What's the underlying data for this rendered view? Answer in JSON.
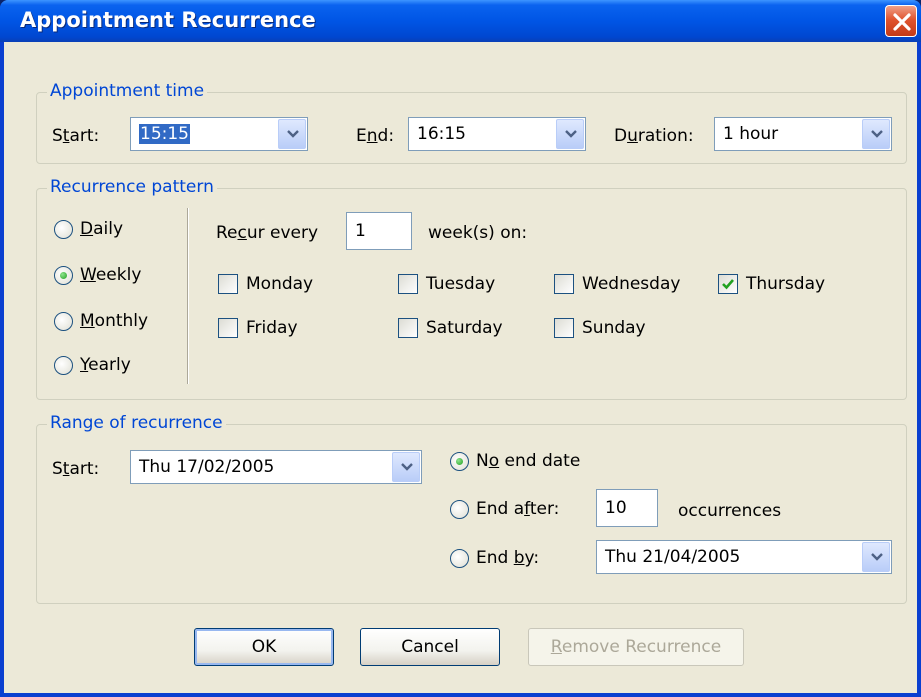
{
  "window": {
    "title": "Appointment Recurrence",
    "close_icon": "close-icon"
  },
  "appointment_time": {
    "legend": "Appointment time",
    "start_label": "Start:",
    "start_value": "15:15",
    "end_label": "End:",
    "end_value": "16:15",
    "duration_label": "Duration:",
    "duration_value": "1 hour"
  },
  "recurrence_pattern": {
    "legend": "Recurrence pattern",
    "options": [
      {
        "label": "Daily",
        "selected": false
      },
      {
        "label": "Weekly",
        "selected": true
      },
      {
        "label": "Monthly",
        "selected": false
      },
      {
        "label": "Yearly",
        "selected": false
      }
    ],
    "recur_every_label": "Recur every",
    "recur_every_value": "1",
    "weeks_on_label": "week(s) on:",
    "days": [
      {
        "label": "Monday",
        "checked": false
      },
      {
        "label": "Tuesday",
        "checked": false
      },
      {
        "label": "Wednesday",
        "checked": false
      },
      {
        "label": "Thursday",
        "checked": true
      },
      {
        "label": "Friday",
        "checked": false
      },
      {
        "label": "Saturday",
        "checked": false
      },
      {
        "label": "Sunday",
        "checked": false
      }
    ]
  },
  "range": {
    "legend": "Range of recurrence",
    "start_label": "Start:",
    "start_value": "Thu 17/02/2005",
    "no_end_label": "No end date",
    "end_after_label": "End after:",
    "end_after_value": "10",
    "occurrences_label": "occurrences",
    "end_by_label": "End by:",
    "end_by_value": "Thu 21/04/2005",
    "selected": "no_end"
  },
  "buttons": {
    "ok": "OK",
    "cancel": "Cancel",
    "remove": "Remove Recurrence"
  },
  "colors": {
    "accent": "#0046d5",
    "title_bar": "#0055e5",
    "dialog_bg": "#ece9d8"
  }
}
